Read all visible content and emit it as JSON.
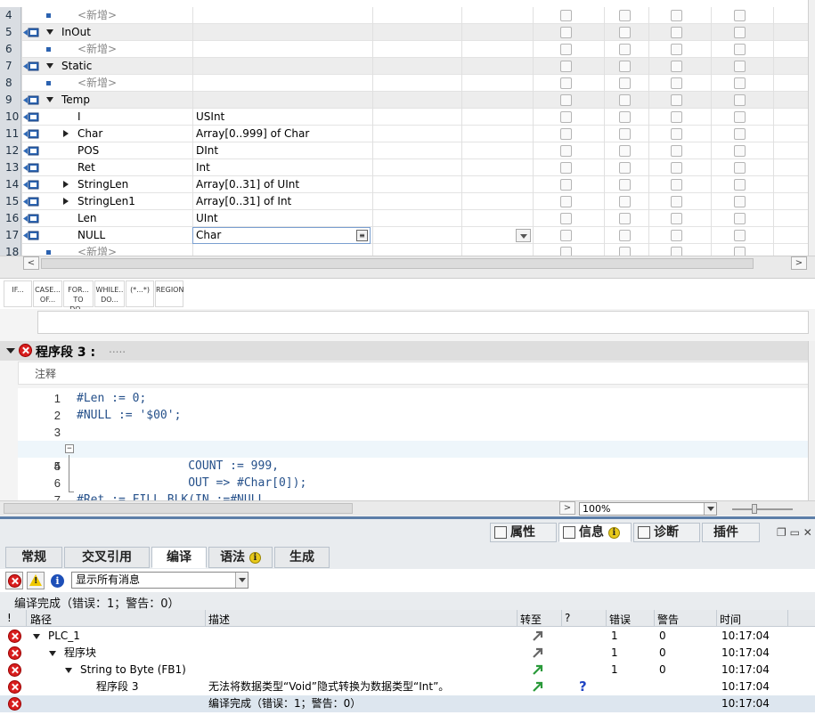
{
  "var_table": {
    "rows": [
      {
        "num": "4",
        "name": "<新增>",
        "type": "",
        "indent": 2,
        "kind": "placeholder"
      },
      {
        "num": "5",
        "name": "InOut",
        "type": "",
        "indent": 0,
        "kind": "section"
      },
      {
        "num": "6",
        "name": "<新增>",
        "type": "",
        "indent": 2,
        "kind": "placeholder"
      },
      {
        "num": "7",
        "name": "Static",
        "type": "",
        "indent": 0,
        "kind": "section"
      },
      {
        "num": "8",
        "name": "<新增>",
        "type": "",
        "indent": 2,
        "kind": "placeholder"
      },
      {
        "num": "9",
        "name": "Temp",
        "type": "",
        "indent": 0,
        "kind": "section"
      },
      {
        "num": "10",
        "name": "I",
        "type": "USInt",
        "indent": 1,
        "kind": "var"
      },
      {
        "num": "11",
        "name": "Char",
        "type": "Array[0..999] of Char",
        "indent": 1,
        "kind": "var-expand"
      },
      {
        "num": "12",
        "name": "POS",
        "type": "DInt",
        "indent": 1,
        "kind": "var"
      },
      {
        "num": "13",
        "name": "Ret",
        "type": "Int",
        "indent": 1,
        "kind": "var"
      },
      {
        "num": "14",
        "name": "StringLen",
        "type": "Array[0..31] of UInt",
        "indent": 1,
        "kind": "var-expand"
      },
      {
        "num": "15",
        "name": "StringLen1",
        "type": "Array[0..31] of Int",
        "indent": 1,
        "kind": "var-expand"
      },
      {
        "num": "16",
        "name": "Len",
        "type": "UInt",
        "indent": 1,
        "kind": "var"
      },
      {
        "num": "17",
        "name": "NULL",
        "type": "Char",
        "indent": 1,
        "kind": "editing"
      },
      {
        "num": "18",
        "name": "<新增>",
        "type": "",
        "indent": 2,
        "kind": "placeholder"
      }
    ]
  },
  "instructions": [
    "IF...",
    "CASE... OF...",
    "FOR... TO DO...",
    "WHILE.. DO...",
    "(*...*)",
    "REGION"
  ],
  "network": {
    "title": "程序段 3 :",
    "dots": ".....",
    "comment_label": "注释"
  },
  "code": [
    {
      "ln": "1",
      "text": "#Len := 0;"
    },
    {
      "ln": "2",
      "text": "#NULL := '$00';"
    },
    {
      "ln": "3",
      "text": ""
    },
    {
      "ln": "4",
      "text_a": "#Ret",
      "text_b": " := FILL_BLK(IN :=#NULL,"
    },
    {
      "ln": "5",
      "text": "                COUNT := 999,"
    },
    {
      "ln": "6",
      "text": "                OUT => #Char[0]);"
    },
    {
      "ln": "7",
      "text": ""
    }
  ],
  "zoom": "100%",
  "inspector": {
    "tabs": {
      "properties": "属性",
      "info": "信息",
      "diagnostics": "诊断",
      "plugins": "插件"
    },
    "subtabs": [
      "常规",
      "交叉引用",
      "编译",
      "语法",
      "生成"
    ],
    "filter_value": "显示所有消息",
    "summary": "编译完成（错误：1；警告：0）",
    "columns": {
      "bang": "!",
      "path": "路径",
      "desc": "描述",
      "goto": "转至",
      "q": "?",
      "errors": "错误",
      "warnings": "警告",
      "time": "时间"
    },
    "messages": [
      {
        "path": "PLC_1",
        "desc": "",
        "errors": "1",
        "warnings": "0",
        "time": "10:17:04"
      },
      {
        "path": "程序块",
        "desc": "",
        "errors": "1",
        "warnings": "0",
        "time": "10:17:04"
      },
      {
        "path": "String to Byte (FB1)",
        "desc": "",
        "errors": "1",
        "warnings": "0",
        "time": "10:17:04"
      },
      {
        "path": "程序段 3",
        "desc": "无法将数据类型“Void”隐式转换为数据类型“Int”。",
        "errors": "",
        "warnings": "",
        "time": "10:17:04"
      },
      {
        "path": "",
        "desc": "编译完成（错误：1；警告：0）",
        "errors": "",
        "warnings": "",
        "time": "10:17:04"
      }
    ]
  },
  "colors": {
    "accent": "#5c7ea8",
    "error": "#d81e1e",
    "code": "#25508a"
  }
}
